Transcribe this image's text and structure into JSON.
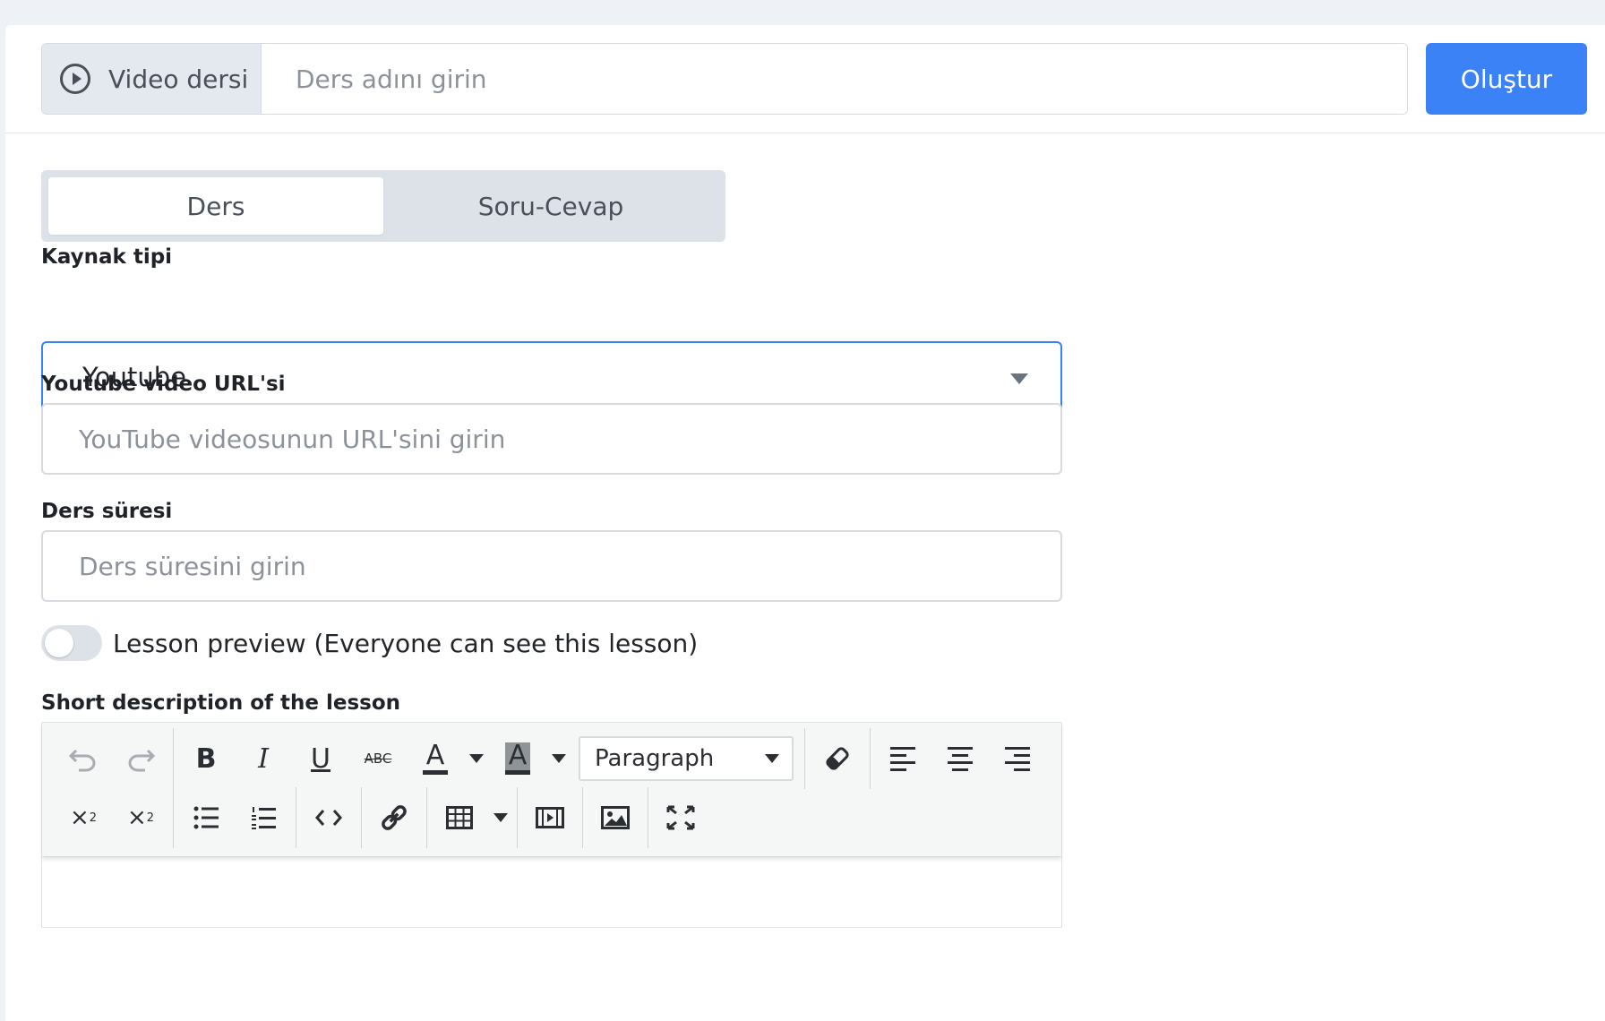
{
  "header": {
    "lesson_type_label": "Video dersi",
    "lesson_type_icon": "play-circle-icon",
    "lesson_name_placeholder": "Ders adını girin",
    "create_label": "Oluştur",
    "accent_color": "#3b82f6"
  },
  "tabs": [
    {
      "label": "Ders",
      "active": true
    },
    {
      "label": "Soru-Cevap",
      "active": false
    }
  ],
  "form": {
    "source_type": {
      "label": "Kaynak tipi",
      "value": "Youtube"
    },
    "youtube_url": {
      "label": "Youtube video URL'si",
      "placeholder": "YouTube videosunun URL'sini girin",
      "value": ""
    },
    "duration": {
      "label": "Ders süresi",
      "placeholder": "Ders süresini girin",
      "value": ""
    },
    "preview": {
      "label": "Lesson preview (Everyone can see this lesson)",
      "enabled": false
    },
    "description": {
      "label": "Short description of the lesson"
    }
  },
  "editor": {
    "paragraph_label": "Paragraph",
    "icons_row1": [
      "undo-icon",
      "redo-icon",
      "bold-icon",
      "italic-icon",
      "underline-icon",
      "strikethrough-icon",
      "font-color-icon",
      "highlight-color-icon",
      "paragraph-style-select",
      "eraser-icon",
      "align-left-icon",
      "align-center-icon",
      "align-right-icon"
    ],
    "icons_row2": [
      "subscript-icon",
      "superscript-icon",
      "unordered-list-icon",
      "ordered-list-icon",
      "code-view-icon",
      "link-icon",
      "table-icon",
      "video-icon",
      "picture-icon",
      "fullscreen-icon"
    ]
  }
}
